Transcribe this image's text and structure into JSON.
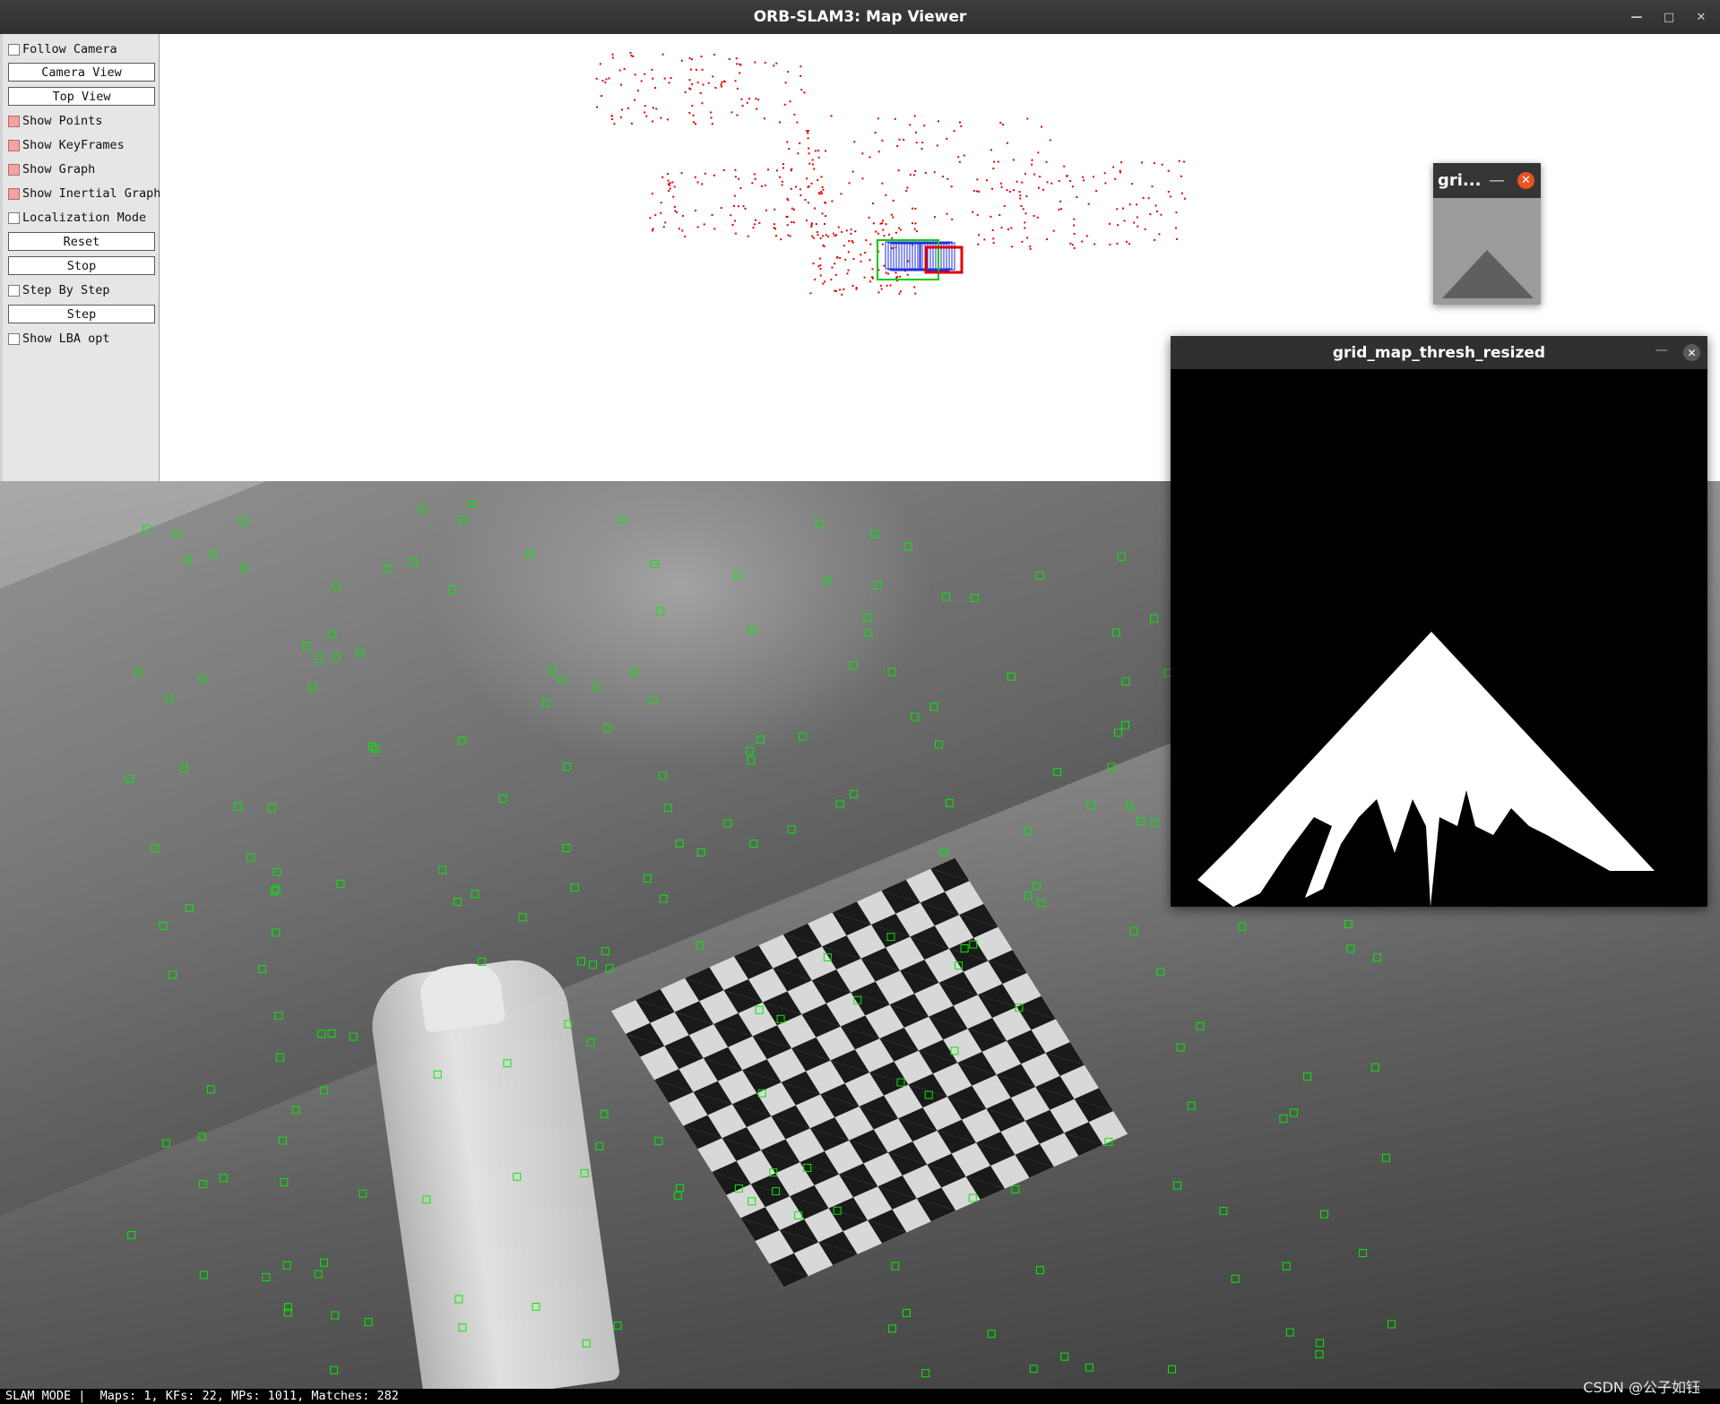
{
  "window": {
    "title": "ORB-SLAM3: Map Viewer",
    "controls": {
      "minimize": "—",
      "maximize": "□",
      "close": "✕"
    }
  },
  "panel": {
    "follow_camera": "Follow Camera",
    "camera_view": "Camera View",
    "top_view": "Top View",
    "show_points": "Show Points",
    "show_keyframes": "Show KeyFrames",
    "show_graph": "Show Graph",
    "show_inertial_graph": "Show Inertial Graph",
    "localization_mode": "Localization Mode",
    "reset": "Reset",
    "stop": "Stop",
    "step_by_step": "Step By Step",
    "step": "Step",
    "show_lba_opt": "Show LBA opt",
    "checked": {
      "follow_camera": false,
      "show_points": true,
      "show_keyframes": true,
      "show_graph": true,
      "show_inertial_graph": true,
      "localization_mode": false,
      "step_by_step": false,
      "show_lba_opt": false
    }
  },
  "status_bar": {
    "text": "SLAM MODE |  Maps: 1, KFs: 22, MPs: 1011, Matches: 282"
  },
  "watermark": "CSDN @公子如钰",
  "small_window": {
    "title": "gri...",
    "minimize": "—",
    "close": "✕"
  },
  "grid_window": {
    "title": "grid_map_thresh_resized",
    "minimize": "—",
    "close": "✕"
  },
  "colors": {
    "map_points": "#e00000",
    "keyframe_current": "#00cc00",
    "keyframes": "#1f2fe0",
    "features": "#00ee00",
    "accent_close": "#e95420"
  }
}
